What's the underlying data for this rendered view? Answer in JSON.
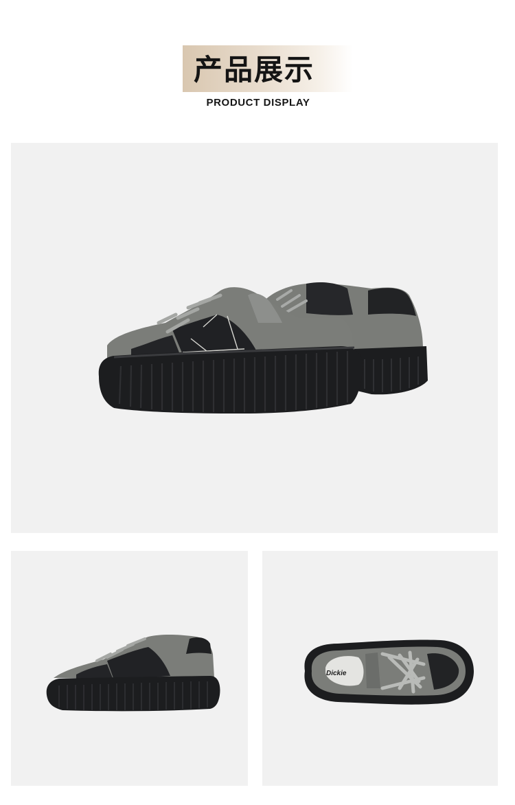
{
  "header": {
    "title_cn": "产品展示",
    "title_en": "PRODUCT DISPLAY"
  },
  "photos": {
    "main": {
      "subject": "pair-of-sneakers"
    },
    "side": {
      "subject": "single-sneaker-side"
    },
    "top": {
      "subject": "single-sneaker-top",
      "brand_text": "Dickie"
    }
  },
  "colors": {
    "photo_bg": "#f1f1f1",
    "suede_gray": "#7a7c78",
    "mesh_black": "#222325",
    "sole_black": "#1c1d1f",
    "title_band": "#d9c7b0"
  }
}
